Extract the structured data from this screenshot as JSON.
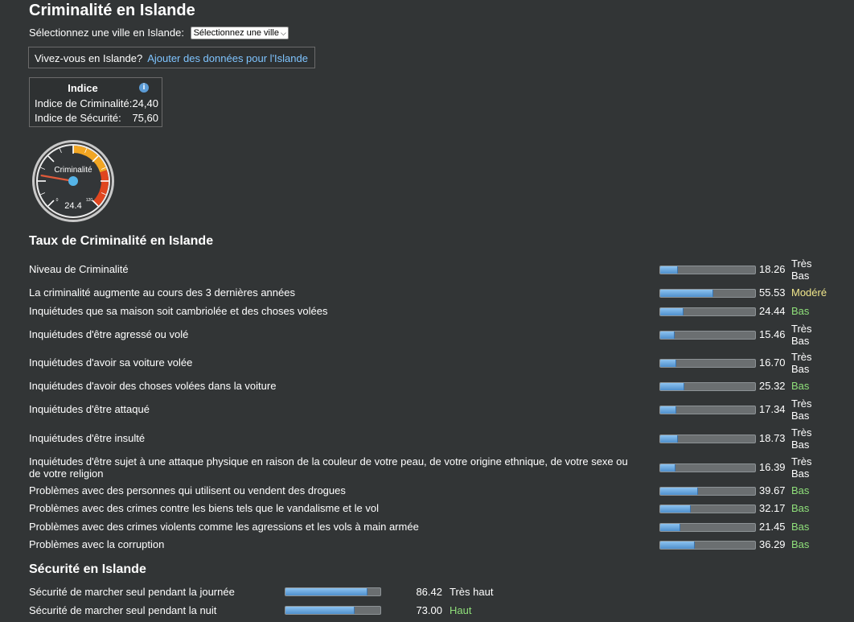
{
  "page": {
    "title": "Criminalité en Islande",
    "city_label": "Sélectionnez une ville en Islande:",
    "city_select_value": "Sélectionnez une ville",
    "live_question": "Vivez-vous en Islande?",
    "live_link": "Ajouter des données pour l'Islande"
  },
  "index": {
    "header": "Indice",
    "info_icon": "info-icon",
    "crime_label": "Indice de Criminalité:",
    "crime_value": "24,40",
    "safety_label": "Indice de Sécurité:",
    "safety_value": "75,60"
  },
  "gauge": {
    "label": "Criminalité",
    "value": 24.4,
    "value_text": "24.4",
    "min_text": "0",
    "max_text": "120",
    "min": 0,
    "max": 120
  },
  "crime_section": {
    "title": "Taux de Criminalité en Islande",
    "rows": [
      {
        "label": "Niveau de Criminalité",
        "value": "18.26",
        "level": "Très Bas",
        "pct": 18.26
      },
      {
        "label": "La criminalité augmente au cours des 3 dernières années",
        "value": "55.53",
        "level": "Modéré",
        "pct": 55.53
      },
      {
        "label": "Inquiétudes que sa maison soit cambriolée et des choses volées",
        "value": "24.44",
        "level": "Bas",
        "pct": 24.44
      },
      {
        "label": "Inquiétudes d'être agressé ou volé",
        "value": "15.46",
        "level": "Très Bas",
        "pct": 15.46
      },
      {
        "label": "Inquiétudes d'avoir sa voiture volée",
        "value": "16.70",
        "level": "Très Bas",
        "pct": 16.7
      },
      {
        "label": "Inquiétudes d'avoir des choses volées dans la voiture",
        "value": "25.32",
        "level": "Bas",
        "pct": 25.32
      },
      {
        "label": "Inquiétudes d'être attaqué",
        "value": "17.34",
        "level": "Très Bas",
        "pct": 17.34
      },
      {
        "label": "Inquiétudes d'être insulté",
        "value": "18.73",
        "level": "Très Bas",
        "pct": 18.73
      },
      {
        "label": "Inquiétudes d'être sujet à une attaque physique en raison de la couleur de votre peau, de votre origine ethnique, de votre sexe ou de votre religion",
        "value": "16.39",
        "level": "Très Bas",
        "pct": 16.39
      },
      {
        "label": "Problèmes avec des personnes qui utilisent ou vendent des drogues",
        "value": "39.67",
        "level": "Bas",
        "pct": 39.67
      },
      {
        "label": "Problèmes avec des crimes contre les biens tels que le vandalisme et le vol",
        "value": "32.17",
        "level": "Bas",
        "pct": 32.17
      },
      {
        "label": "Problèmes avec des crimes violents comme les agressions et les vols à main armée",
        "value": "21.45",
        "level": "Bas",
        "pct": 21.45
      },
      {
        "label": "Problèmes avec la corruption",
        "value": "36.29",
        "level": "Bas",
        "pct": 36.29
      }
    ]
  },
  "safety_section": {
    "title": "Sécurité en Islande",
    "rows": [
      {
        "label": "Sécurité de marcher seul pendant la journée",
        "value": "86.42",
        "level": "Très haut",
        "pct": 86.42
      },
      {
        "label": "Sécurité de marcher seul pendant la nuit",
        "value": "73.00",
        "level": "Haut",
        "pct": 73.0
      }
    ]
  },
  "colors": {
    "background": "#323536",
    "link": "#7fc4ff",
    "level_low": "#8fe07a",
    "level_moderate": "#f0e68c",
    "bar_fill": "#6aa8e0"
  }
}
